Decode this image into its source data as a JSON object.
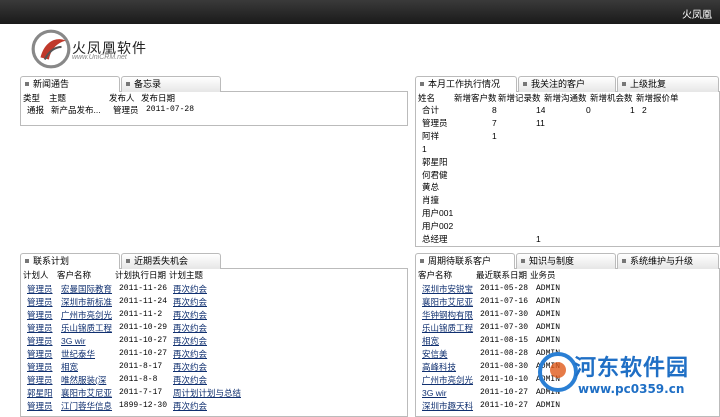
{
  "window": {
    "title": "火凤凰"
  },
  "logo": {
    "title": "火凤凰软件",
    "url": "www.UniCRM.net"
  },
  "news": {
    "tabs": [
      "新闻通告",
      "备忘录"
    ],
    "headers": [
      "类型",
      "主题",
      "发布人",
      "发布日期"
    ],
    "rows": [
      {
        "type": "通报",
        "subject": "新产品发布...",
        "publisher": "管理员",
        "date": "2011-07-28"
      }
    ]
  },
  "work": {
    "tabs": [
      "本月工作执行情况",
      "我关注的客户",
      "上级批复"
    ],
    "headers": [
      "姓名",
      "新增客户数",
      "新增记录数",
      "新增沟通数",
      "新增机会数",
      "新增报价单"
    ],
    "rows": [
      {
        "name": "合计",
        "customers": "8",
        "records": "14",
        "comms": "0",
        "opps": "1",
        "quotes": "2"
      },
      {
        "name": "管理员",
        "customers": "7",
        "records": "11",
        "comms": "",
        "opps": "",
        "quotes": ""
      },
      {
        "name": "阿祥",
        "customers": "1",
        "records": "",
        "comms": "",
        "opps": "",
        "quotes": ""
      },
      {
        "name": "1",
        "customers": "",
        "records": "",
        "comms": "",
        "opps": "",
        "quotes": ""
      },
      {
        "name": "郭星阳",
        "customers": "",
        "records": "",
        "comms": "",
        "opps": "",
        "quotes": ""
      },
      {
        "name": "何君健",
        "customers": "",
        "records": "",
        "comms": "",
        "opps": "",
        "quotes": ""
      },
      {
        "name": "黄总",
        "customers": "",
        "records": "",
        "comms": "",
        "opps": "",
        "quotes": ""
      },
      {
        "name": "肖撞",
        "customers": "",
        "records": "",
        "comms": "",
        "opps": "",
        "quotes": ""
      },
      {
        "name": "用户001",
        "customers": "",
        "records": "",
        "comms": "",
        "opps": "",
        "quotes": ""
      },
      {
        "name": "用户002",
        "customers": "",
        "records": "",
        "comms": "",
        "opps": "",
        "quotes": ""
      },
      {
        "name": "总经理",
        "customers": "",
        "records": "1",
        "comms": "",
        "opps": "",
        "quotes": ""
      }
    ]
  },
  "plan": {
    "tabs": [
      "联系计划",
      "近期丢失机会"
    ],
    "headers": [
      "计划人",
      "客户名称",
      "计划执行日期",
      "计划主题"
    ],
    "rows": [
      {
        "planner": "管理员",
        "customer": "宏曼国际教育",
        "date": "2011-11-26",
        "topic": "再次约会"
      },
      {
        "planner": "管理员",
        "customer": "深圳市新标准",
        "date": "2011-11-24",
        "topic": "再次约会"
      },
      {
        "planner": "管理员",
        "customer": "广州市亮剑光",
        "date": "2011-11-2",
        "topic": "再次约会"
      },
      {
        "planner": "管理员",
        "customer": "乐山锦质工程",
        "date": "2011-10-29",
        "topic": "再次约会"
      },
      {
        "planner": "管理员",
        "customer": "3G wir",
        "date": "2011-10-27",
        "topic": "再次约会"
      },
      {
        "planner": "管理员",
        "customer": "世纪泰华",
        "date": "2011-10-27",
        "topic": "再次约会"
      },
      {
        "planner": "管理员",
        "customer": "相宽",
        "date": "2011-8-17",
        "topic": "再次约会"
      },
      {
        "planner": "管理员",
        "customer": "唯然服装(深",
        "date": "2011-8-8",
        "topic": "再次约会"
      },
      {
        "planner": "郭星阳",
        "customer": "襄阳市艾尼亚",
        "date": "2011-7-17",
        "topic": "周计划计划与总结"
      },
      {
        "planner": "管理员",
        "customer": "江门蓉华信息",
        "date": "1899-12-30",
        "topic": "再次约会"
      }
    ]
  },
  "followup": {
    "tabs": [
      "周期待联系客户",
      "知识与制度",
      "系统维护与升级"
    ],
    "headers": [
      "客户名称",
      "最近联系日期",
      "业务员"
    ],
    "rows": [
      {
        "customer": "深圳市安锐宝",
        "date": "2011-05-28",
        "rep": "ADMIN"
      },
      {
        "customer": "襄阳市艾尼亚",
        "date": "2011-07-16",
        "rep": "ADMIN"
      },
      {
        "customer": "华钟钢构有限",
        "date": "2011-07-30",
        "rep": "ADMIN"
      },
      {
        "customer": "乐山锦质工程",
        "date": "2011-07-30",
        "rep": "ADMIN"
      },
      {
        "customer": "相宽",
        "date": "2011-08-15",
        "rep": "ADMIN"
      },
      {
        "customer": "安信美",
        "date": "2011-08-28",
        "rep": "ADMIN"
      },
      {
        "customer": "高峰科技",
        "date": "2011-08-30",
        "rep": "ADMIN"
      },
      {
        "customer": "广州市亮剑光",
        "date": "2011-10-10",
        "rep": "ADMIN"
      },
      {
        "customer": "3G wir",
        "date": "2011-10-27",
        "rep": "ADMIN"
      },
      {
        "customer": "深圳市趣天科",
        "date": "2011-10-27",
        "rep": "ADMIN"
      }
    ]
  },
  "watermark": {
    "name": "河东软件园",
    "url": "www.pc0359.cn"
  }
}
